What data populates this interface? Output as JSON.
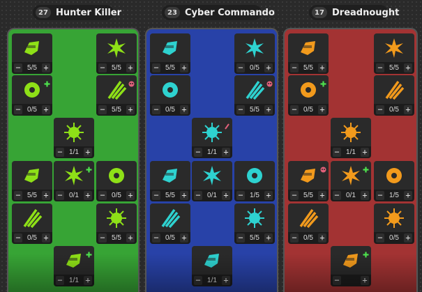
{
  "trees": [
    {
      "id": "hunter",
      "name": "Hunter Killer",
      "points": "27",
      "color": "#37a435",
      "icon_color": "#8ee017",
      "talents": [
        {
          "icon": "ammo-clip-icon",
          "rank": "5/5"
        },
        {
          "icon": "explosion-burst-icon",
          "rank": "5/5"
        },
        {
          "icon": "biohazard-icon",
          "rank": "0/5",
          "mark": "plus"
        },
        {
          "icon": "slashing-claws-icon",
          "rank": "5/5",
          "mark": "skull"
        },
        {
          "icon": "shattered-blast-icon",
          "rank": "1/1"
        },
        {
          "icon": "spiked-gear-icon",
          "rank": "5/5"
        },
        {
          "icon": "heavy-cannon-icon",
          "rank": "0/1",
          "mark": "plus"
        },
        {
          "icon": "weapon-crate-icon",
          "rank": "0/5"
        },
        {
          "icon": "shield-emblem-icon",
          "rank": "0/5"
        },
        {
          "icon": "skull-icon",
          "rank": "5/5"
        },
        {
          "icon": "energy-claws-icon",
          "rank": "1/1",
          "mark": "plus"
        }
      ]
    },
    {
      "id": "cyber",
      "name": "Cyber Commando",
      "points": "23",
      "color": "#2842a8",
      "icon_color": "#2ed2d0",
      "talents": [
        {
          "icon": "laser-pyramid-icon",
          "rank": "5/5"
        },
        {
          "icon": "cyborg-head-icon",
          "rank": "0/5"
        },
        {
          "icon": "guitar-weapon-icon",
          "rank": "0/5"
        },
        {
          "icon": "plasma-grenade-icon",
          "rank": "5/5",
          "mark": "skull"
        },
        {
          "icon": "power-gauntlet-icon",
          "rank": "1/1",
          "mark": "slash"
        },
        {
          "icon": "targeting-shield-icon",
          "rank": "5/5"
        },
        {
          "icon": "sprinting-soldier-icon",
          "rank": "0/1"
        },
        {
          "icon": "cyber-heart-icon",
          "rank": "1/5"
        },
        {
          "icon": "kneeling-rifleman-icon",
          "rank": "0/5"
        },
        {
          "icon": "twin-rifles-icon",
          "rank": "5/5"
        },
        {
          "icon": "armored-fist-icon",
          "rank": "1/1"
        }
      ]
    },
    {
      "id": "dread",
      "name": "Dreadnought",
      "points": "17",
      "color": "#a33333",
      "icon_color": "#f29a1c",
      "talents": [
        {
          "icon": "fuel-canister-icon",
          "rank": "5/5"
        },
        {
          "icon": "fortress-icon",
          "rank": "5/5"
        },
        {
          "icon": "power-armor-icon",
          "rank": "0/5",
          "mark": "plus"
        },
        {
          "icon": "tower-shield-icon",
          "rank": "0/5"
        },
        {
          "icon": "radiation-icon",
          "rank": "1/1"
        },
        {
          "icon": "combat-helmet-icon",
          "rank": "5/5",
          "mark": "skull"
        },
        {
          "icon": "control-panel-icon",
          "rank": "0/1",
          "mark": "plus"
        },
        {
          "icon": "gas-mask-icon",
          "rank": "1/5"
        },
        {
          "icon": "mech-fist-icon",
          "rank": "0/5"
        },
        {
          "icon": "battle-bug-icon",
          "rank": "0/5"
        },
        {
          "icon": "drill-bit-icon",
          "rank": "",
          "mark": "plus"
        }
      ]
    }
  ],
  "controls": {
    "minus": "−",
    "plus": "+"
  }
}
